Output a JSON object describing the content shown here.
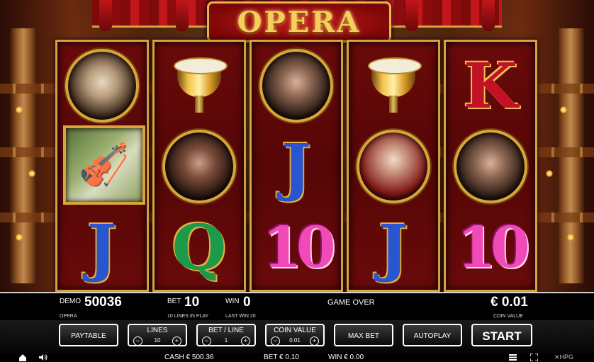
{
  "game": {
    "title": "OPERA",
    "reels": [
      [
        "portrait-handel",
        "violin-sheet-music",
        "letter-j"
      ],
      [
        "timpani-drum",
        "portrait-beethoven",
        "letter-q"
      ],
      [
        "portrait-verdi",
        "letter-j",
        "letter-10"
      ],
      [
        "timpani-drum",
        "portrait-mozart",
        "letter-j"
      ],
      [
        "letter-k",
        "portrait-verdi",
        "letter-10"
      ]
    ],
    "symbol_text": {
      "j": "J",
      "q": "Q",
      "k": "K",
      "ten": "10",
      "violin": "🎻",
      "drum": ""
    }
  },
  "info": {
    "demo_label": "DEMO",
    "demo_value": "50036",
    "demo_sub": "OPERA",
    "bet_label": "BET",
    "bet_value": "10",
    "bet_sub": "10 LINES IN PLAY",
    "win_label": "WIN",
    "win_value": "0",
    "win_sub": "LAST WIN 20",
    "game_status": "GAME OVER",
    "coin_value": "€ 0.01",
    "coin_sub": "COIN VALUE"
  },
  "buttons": {
    "paytable": "PAYTABLE",
    "lines": {
      "label": "LINES",
      "value": "10"
    },
    "bet_line": {
      "label": "BET / LINE",
      "value": "1"
    },
    "coin_value": {
      "label": "COIN VALUE",
      "value": "0.01"
    },
    "max_bet": "MAX BET",
    "autoplay": "AUTOPLAY",
    "start": "START",
    "minus": "−",
    "plus": "+"
  },
  "status": {
    "cash": "CASH € 500.36",
    "bet": "BET € 0.10",
    "win": "WIN € 0.00",
    "provider": "HPG"
  },
  "colors": {
    "frame_gold": "#d7a23c",
    "reel_red": "#6a0a0a",
    "bar_black": "#000000"
  }
}
